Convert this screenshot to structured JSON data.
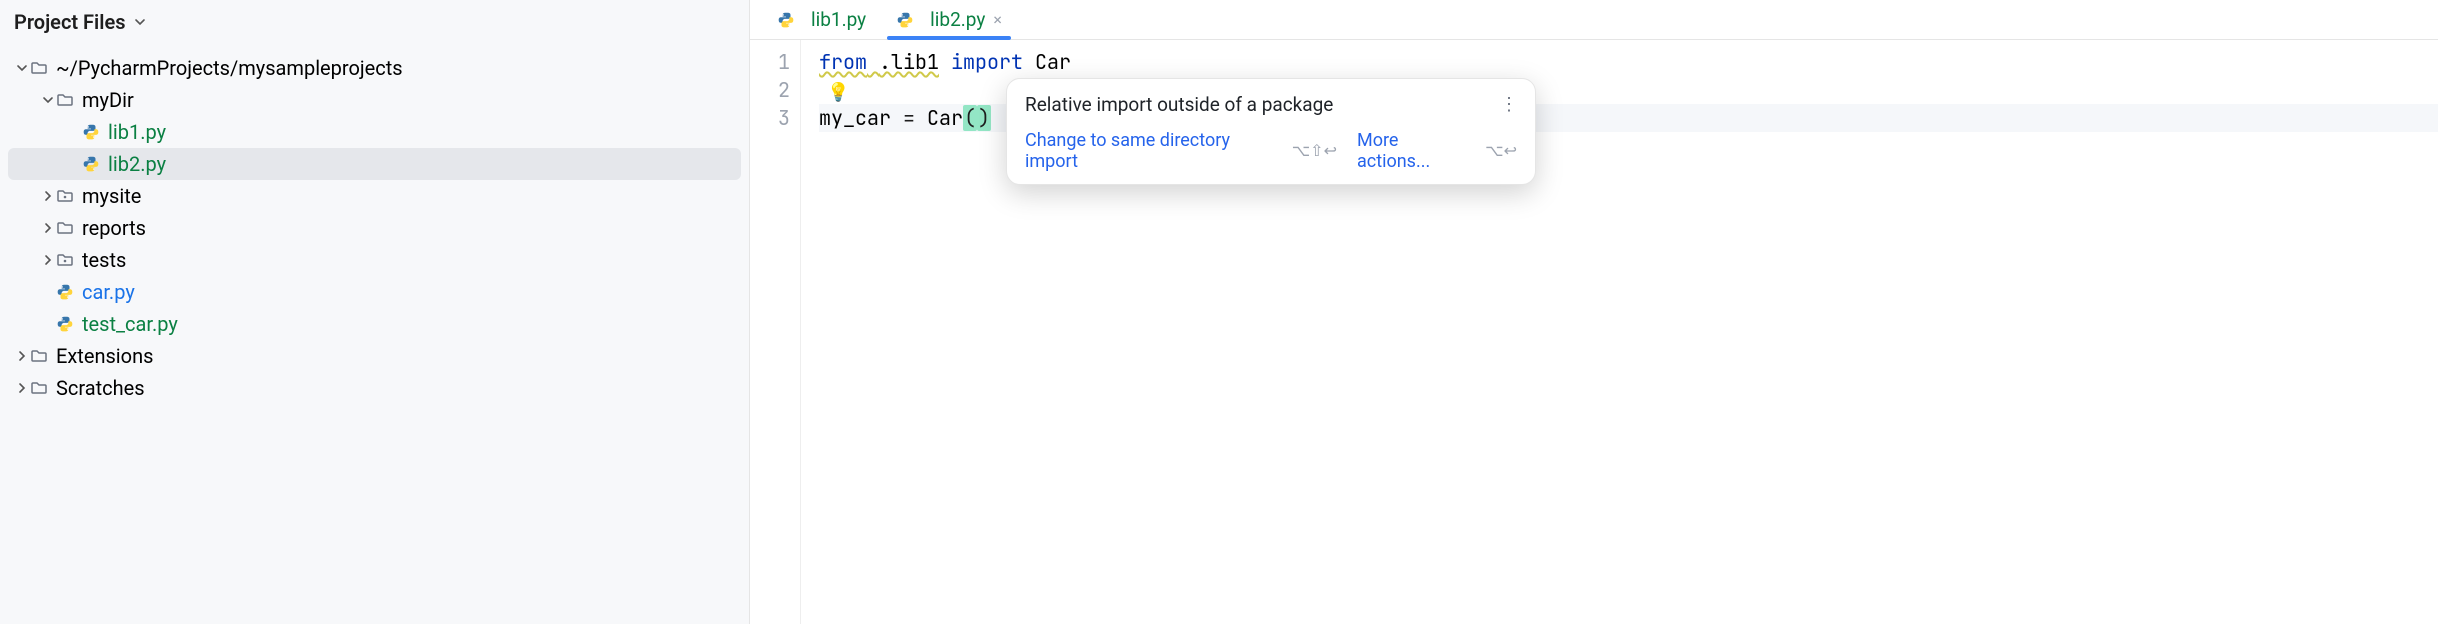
{
  "sidebar": {
    "title": "Project Files",
    "tree": {
      "root": {
        "label": "~/PycharmProjects/mysampleprojects",
        "children": {
          "myDir": {
            "label": "myDir",
            "lib1": "lib1.py",
            "lib2": "lib2.py"
          },
          "mysite": "mysite",
          "reports": "reports",
          "tests": "tests",
          "car": "car.py",
          "test_car": "test_car.py"
        }
      },
      "extensions": "Extensions",
      "scratches": "Scratches"
    }
  },
  "tabs": {
    "t0": {
      "label": "lib1.py"
    },
    "t1": {
      "label": "lib2.py"
    }
  },
  "editor": {
    "lines": {
      "l1": {
        "num": "1",
        "from_kw": "from",
        "module": ".lib1",
        "import_kw": "import",
        "symbol": "Car"
      },
      "l2": {
        "num": "2"
      },
      "l3": {
        "num": "3",
        "var": "my_car",
        "eq": " = ",
        "call": "Car",
        "open": "(",
        "close": ")"
      }
    }
  },
  "intent": {
    "title": "Relative import outside of a package",
    "action1": "Change to same directory import",
    "shortcut1": "⌥⇧↩",
    "action2": "More actions...",
    "shortcut2": "⌥↩"
  }
}
